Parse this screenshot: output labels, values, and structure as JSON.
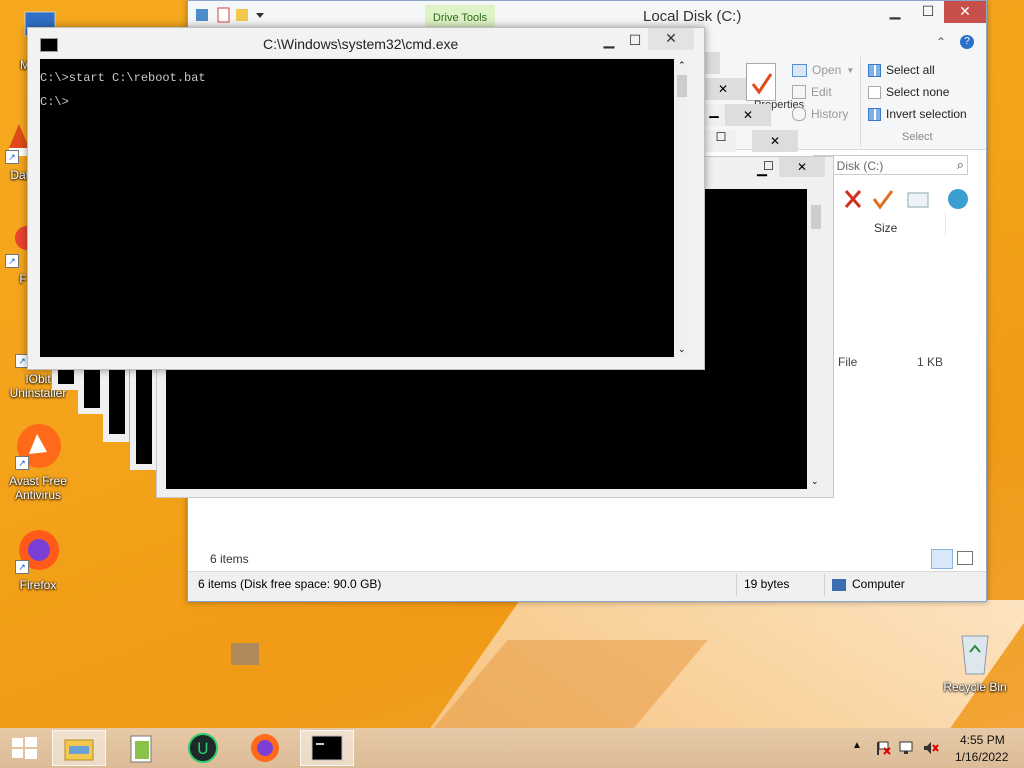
{
  "desktop": {
    "icons": [
      {
        "label": "My C",
        "icon": "computer-icon"
      },
      {
        "label": "Data",
        "icon": "data-icon"
      },
      {
        "label": "F",
        "icon": "app-icon"
      },
      {
        "label": "IObit Uninstaller",
        "icon": "iobit-uninstaller-icon"
      },
      {
        "label": "Avast Free Antivirus",
        "icon": "avast-icon"
      },
      {
        "label": "Firefox",
        "icon": "firefox-icon"
      },
      {
        "label": "Recycle Bin",
        "icon": "recycle-bin-icon"
      }
    ],
    "colors": {
      "background": "#f4a21a"
    }
  },
  "explorer": {
    "title": "Local Disk (C:)",
    "context_tab": "Drive Tools",
    "ribbon": {
      "open": "Open",
      "edit": "Edit",
      "history": "History",
      "properties_partial": "Properties",
      "select_all": "Select all",
      "select_none": "Select none",
      "invert_selection": "Invert selection",
      "select_group": "Select"
    },
    "search_placeholder": "cal Disk (C:)",
    "column_size": "Size",
    "row": {
      "type": "n File",
      "size": "1 KB"
    },
    "items_count": "6 items",
    "status": {
      "summary": "6 items (Disk free space: 90.0 GB)",
      "selection": "19 bytes",
      "location": "Computer"
    }
  },
  "cmd": {
    "title": "C:\\Windows\\system32\\cmd.exe",
    "lines": [
      "C:\\>start C:\\reboot.bat",
      "C:\\>"
    ]
  },
  "taskbar": {
    "apps": [
      "file-explorer-icon",
      "notepad-plus-plus-icon",
      "iobit-uninstaller-icon",
      "firefox-icon",
      "cmd-icon"
    ],
    "clock": {
      "time": "4:55 PM",
      "date": "1/16/2022"
    }
  }
}
